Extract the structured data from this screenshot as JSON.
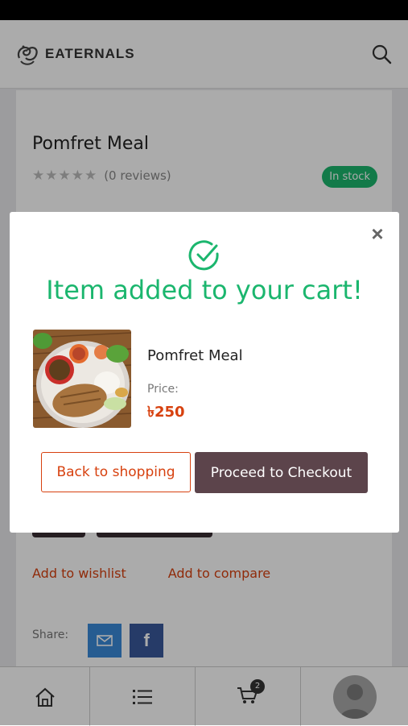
{
  "app": {
    "logo_text": "EATERNALS"
  },
  "product": {
    "title": "Pomfret Meal",
    "stars": "★★★★★",
    "reviews": "(0 reviews)",
    "stock": "In stock"
  },
  "links": {
    "wishlist": "Add to wishlist",
    "compare": "Add to compare"
  },
  "share": {
    "label": "Share:",
    "fb_glyph": "f"
  },
  "tabbar": {
    "cart_count": "2",
    "icons": [
      "home-icon",
      "list-icon",
      "cart-icon",
      "avatar"
    ]
  },
  "modal": {
    "title": "Item added to your cart!",
    "close": "×",
    "item_name": "Pomfret Meal",
    "price_label": "Price:",
    "price": "৳250",
    "back_label": "Back to shopping",
    "checkout_label": "Proceed to Checkout"
  },
  "colors": {
    "accent_green": "#1bb66e",
    "accent_orange": "#d7410f",
    "checkout_bg": "#5c444b"
  }
}
